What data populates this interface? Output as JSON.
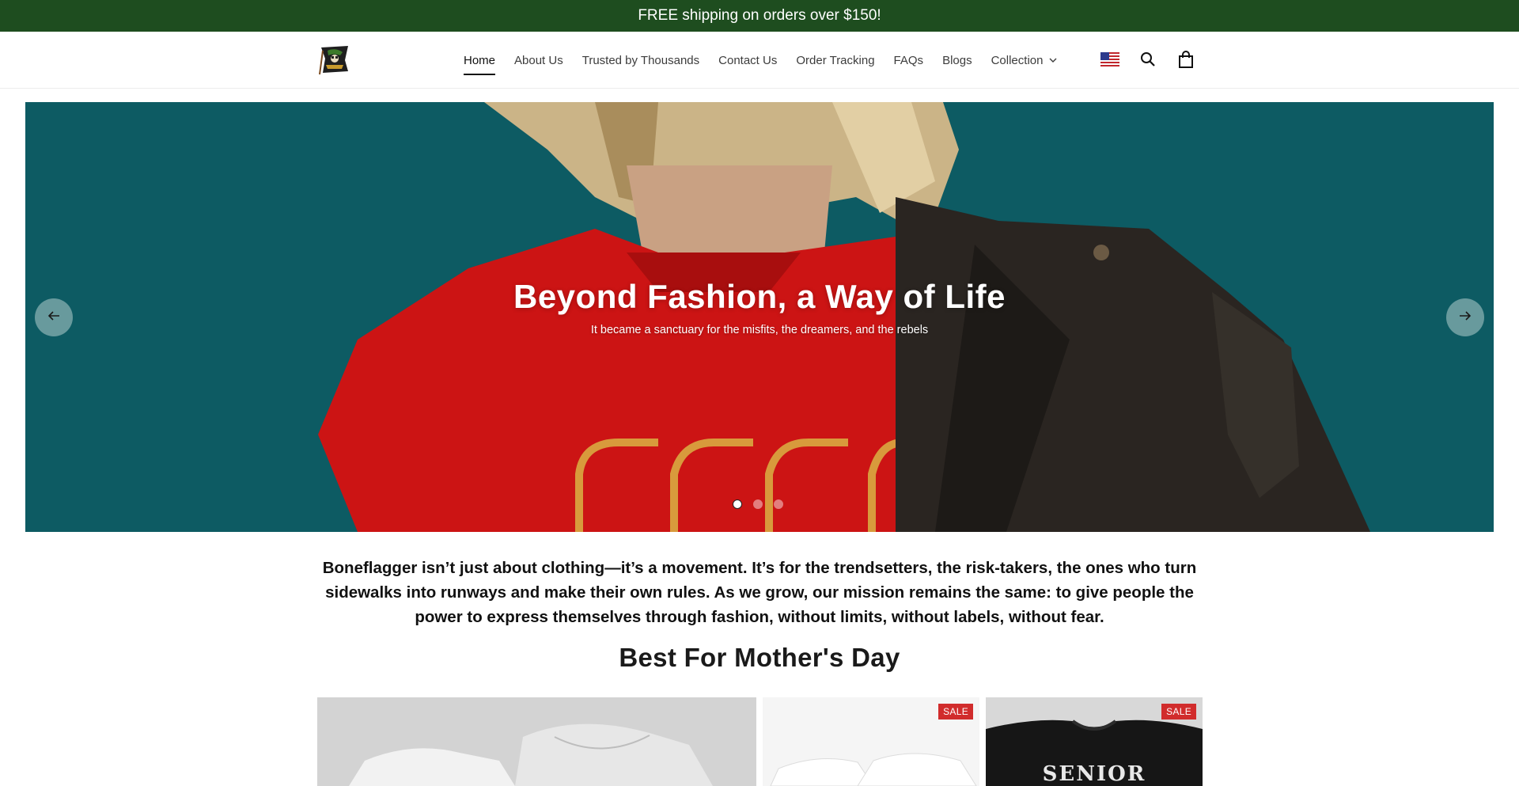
{
  "announcement": {
    "text": "FREE shipping on orders over $150!"
  },
  "header": {
    "logo_alt": "Boneflagger",
    "nav": [
      {
        "label": "Home",
        "active": true
      },
      {
        "label": "About Us"
      },
      {
        "label": "Trusted by Thousands"
      },
      {
        "label": "Contact Us"
      },
      {
        "label": "Order Tracking"
      },
      {
        "label": "FAQs"
      },
      {
        "label": "Blogs"
      },
      {
        "label": "Collection",
        "has_dropdown": true
      }
    ],
    "icons": [
      "us-flag-icon",
      "search-icon",
      "shopping-bag-icon"
    ]
  },
  "hero": {
    "title": "Beyond Fashion, a Way of Life",
    "subtitle": "It became a sanctuary for the misfits, the dreamers, and the rebels",
    "slide_count": 3,
    "active_slide": 1
  },
  "intro": {
    "text": "Boneflagger isn’t just about clothing—it’s a movement. It’s for the trendsetters, the risk-takers, the ones who turn sidewalks into runways and make their own rules. As we grow, our mission remains the same: to give people the power to express themselves through fashion, without limits, without labels, without fear."
  },
  "collection": {
    "title": "Best For Mother's Day",
    "products": [
      {
        "badge": ""
      },
      {
        "badge": "SALE"
      },
      {
        "badge": "SALE",
        "print_text": "SENIOR"
      }
    ]
  },
  "colors": {
    "announcement_bg": "#1e4d1f",
    "hero_bg": "#0f6068",
    "shirt_red": "#cc1414",
    "sale_badge": "#d12c2c"
  }
}
